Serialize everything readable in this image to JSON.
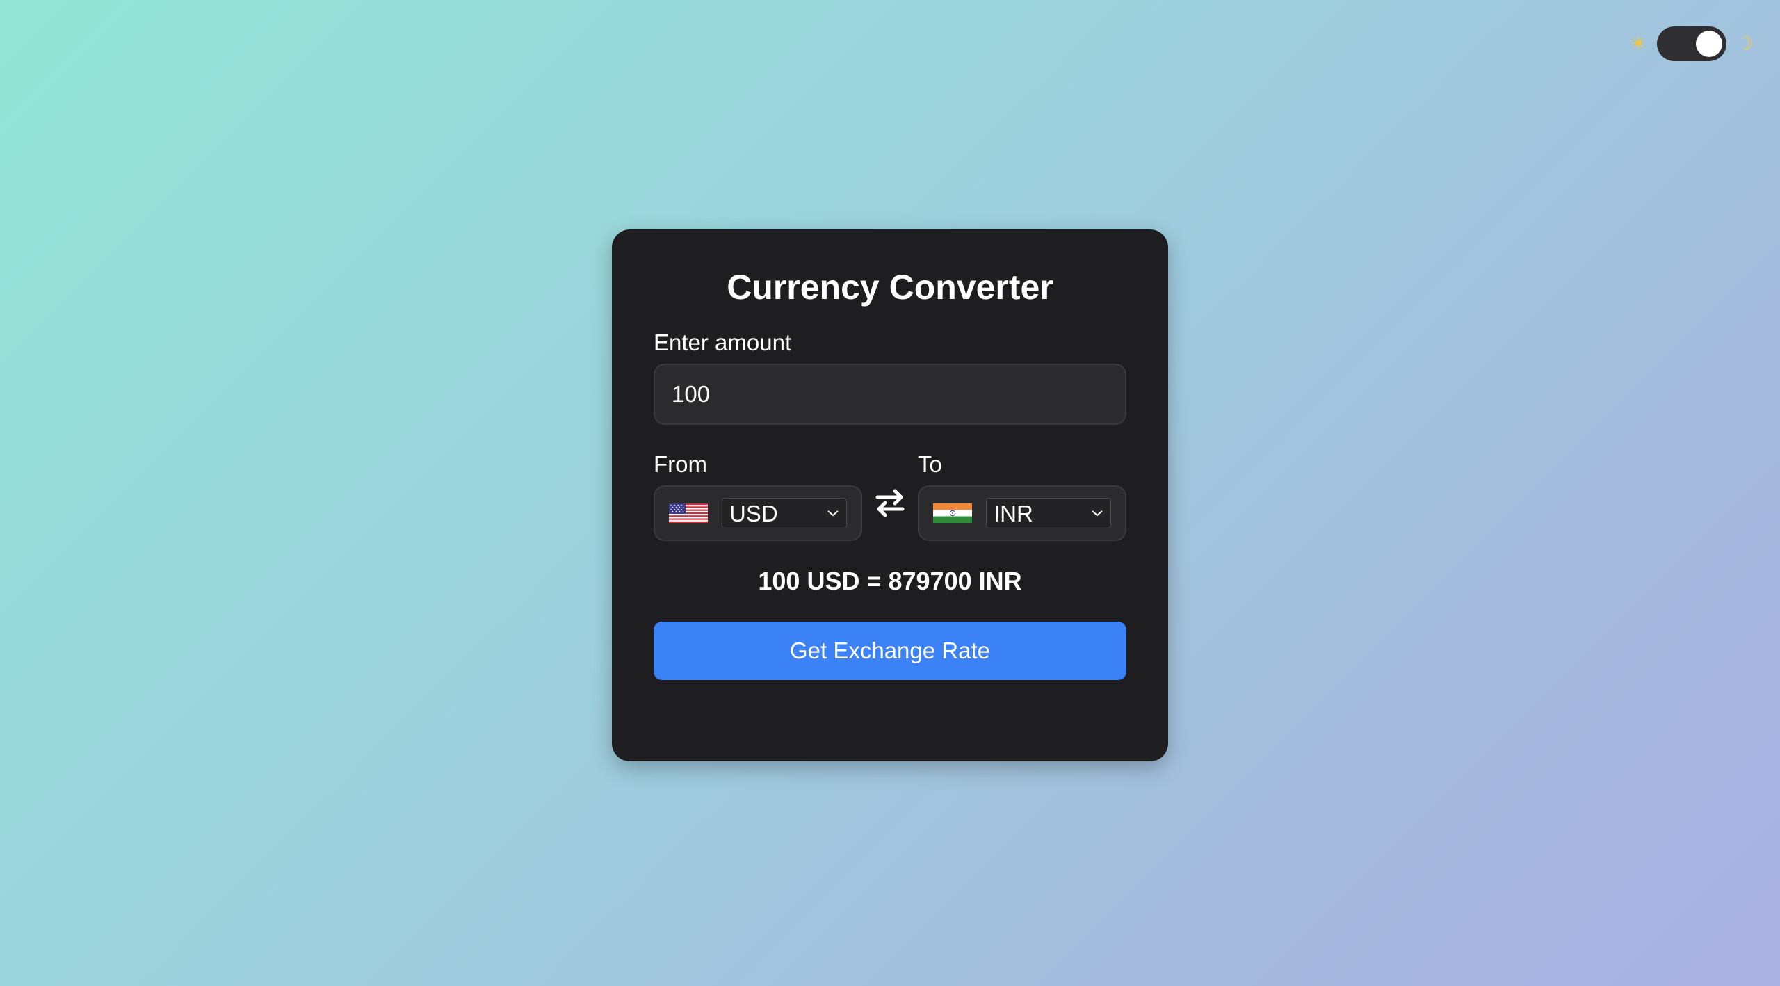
{
  "theme_toggle": {
    "sun_glyph": "☀",
    "moon_glyph": "☽",
    "state": "dark",
    "sun_icon": "sun-icon",
    "moon_icon": "moon-icon"
  },
  "card": {
    "title": "Currency Converter",
    "amount_label": "Enter amount",
    "amount_value": "100",
    "from": {
      "label": "From",
      "currency": "USD",
      "flag_icon": "us-flag-icon"
    },
    "to": {
      "label": "To",
      "currency": "INR",
      "flag_icon": "india-flag-icon"
    },
    "swap_icon": "swap-arrows-icon",
    "result": "100 USD = 879700 INR",
    "button_label": "Get Exchange Rate"
  },
  "colors": {
    "card_bg": "#1e1e21",
    "button": "#3b82f6",
    "background_start": "#93e6d6",
    "background_end": "#aab1e3"
  }
}
